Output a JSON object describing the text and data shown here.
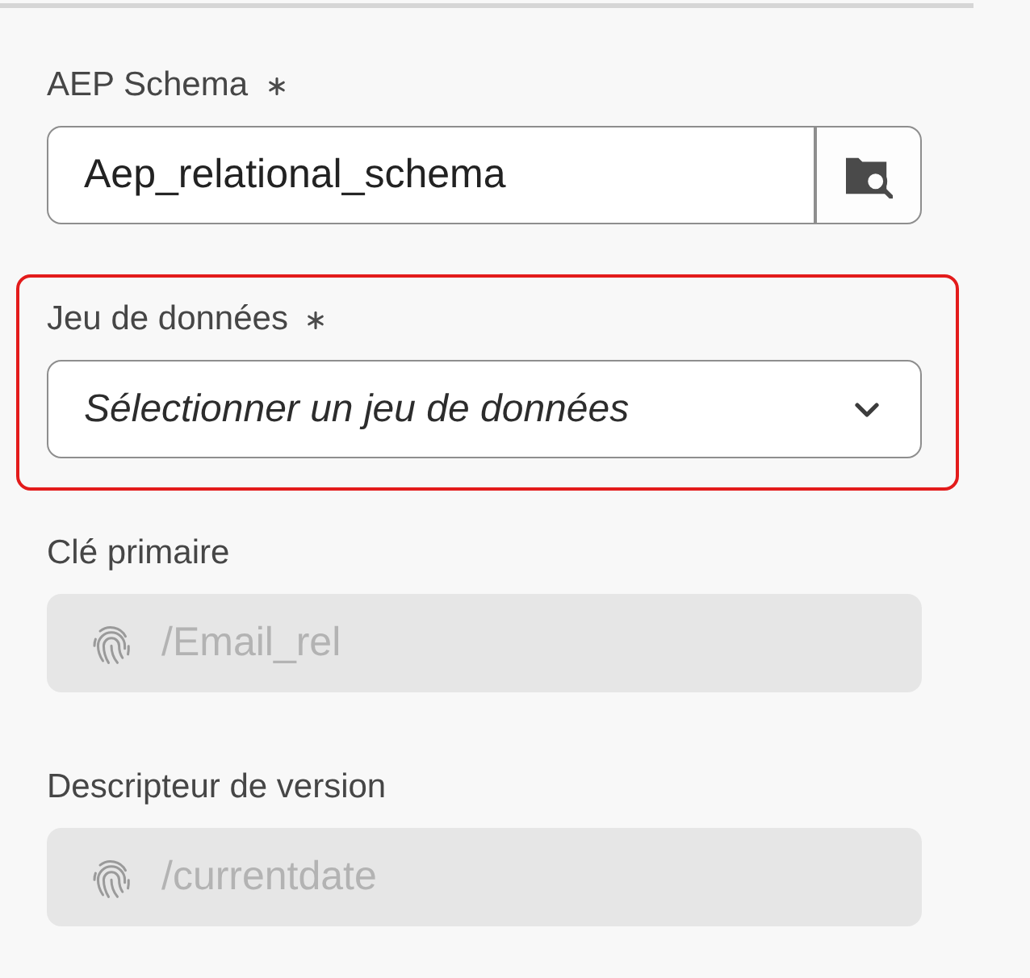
{
  "fields": [
    {
      "kind": "search",
      "label": "AEP Schema",
      "required": true,
      "value": "Aep_relational_schema",
      "highlighted": false,
      "disabled": false
    },
    {
      "kind": "dropdown",
      "label": "Jeu de données",
      "required": true,
      "placeholder": "Sélectionner un jeu de données",
      "highlighted": true,
      "disabled": false
    },
    {
      "kind": "identity",
      "label": "Clé primaire",
      "required": false,
      "value": "/Email_rel",
      "highlighted": false,
      "disabled": true
    },
    {
      "kind": "identity",
      "label": "Descripteur de version",
      "required": false,
      "value": "/currentdate",
      "highlighted": false,
      "disabled": true
    }
  ]
}
